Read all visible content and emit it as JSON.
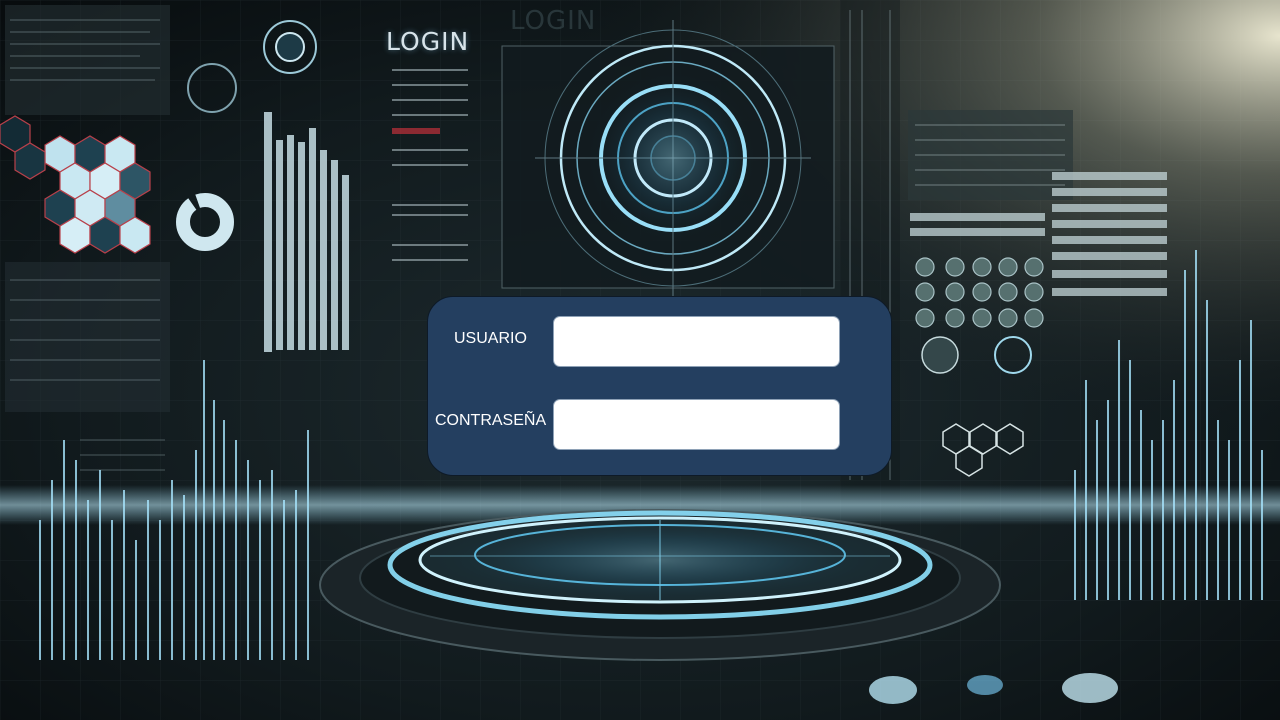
{
  "header": {
    "title": "LOGIN"
  },
  "login_form": {
    "username_label": "USUARIO",
    "username_value": "",
    "password_label": "CONTRASEÑA",
    "password_value": ""
  },
  "colors": {
    "panel": "#243f60",
    "field": "#ffffff",
    "accent_glow": "#7fd3ff",
    "background": "#0b1114"
  }
}
